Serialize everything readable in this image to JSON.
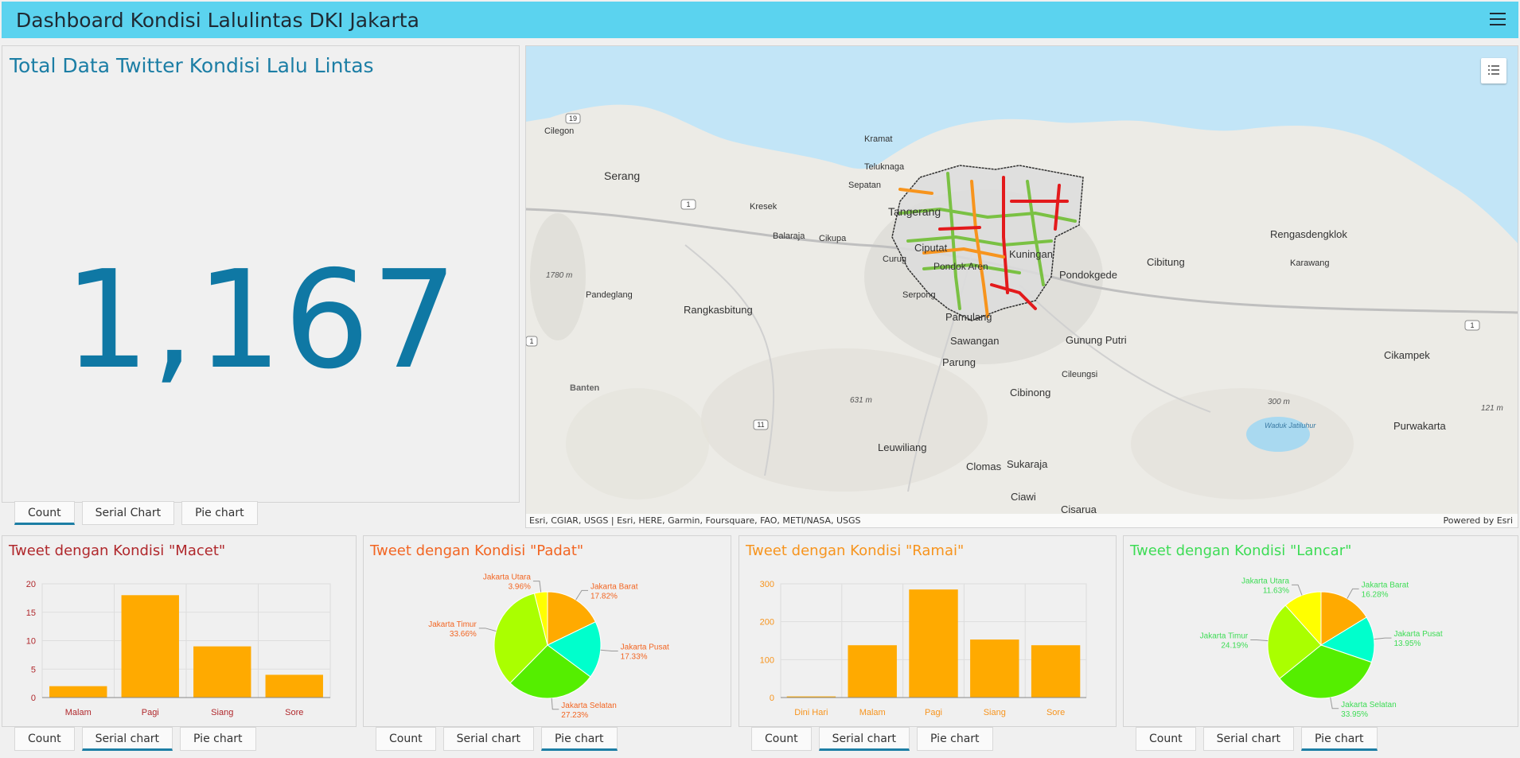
{
  "header": {
    "title": "Dashboard Kondisi Lalulintas DKI Jakarta",
    "menu_icon": "hamburger-menu-icon"
  },
  "count": {
    "title": "Total Data Twitter Kondisi Lalu Lintas",
    "value": "1,167",
    "color": "#0f78a4"
  },
  "top_tabs": [
    "Count",
    "Serial Chart",
    "Pie chart"
  ],
  "map": {
    "attribution": "Esri, CGIAR, USGS | Esri, HERE, Garmin, Foursquare, FAO, METI/NASA, USGS",
    "powered_by": "Powered by Esri",
    "places": [
      "Cilegon",
      "Serang",
      "Kramat",
      "Teluknaga",
      "Sepatan",
      "Kresek",
      "Tangerang",
      "Balaraja",
      "Cikupa",
      "Curug",
      "Ciputat",
      "Pondok Aren",
      "Kuningan",
      "Pondokgede",
      "Cibitung",
      "Rengasdengklok",
      "Karawang",
      "Pandeglang",
      "Rangkasbitung",
      "Serpong",
      "Pamulang",
      "Sawangan",
      "Gunung Putri",
      "Parung",
      "Cileungsi",
      "Cikampek",
      "Banten",
      "Cibinong",
      "Purwakarta",
      "Leuwiliang",
      "Clomas",
      "Sukaraja",
      "Ciawi",
      "Cisarua",
      "Waduk Jatiluhur"
    ],
    "elevations": [
      "1780 m",
      "631 m",
      "300 m",
      "121 m"
    ],
    "road_shields": [
      "19",
      "1",
      "1",
      "1",
      "11"
    ],
    "legend_icon": "legend-list-icon"
  },
  "macet": {
    "title": "Tweet dengan Kondisi \"Macet\"",
    "title_color": "#b0282c",
    "tabs": [
      "Count",
      "Serial chart",
      "Pie chart"
    ],
    "chart_data": {
      "type": "bar",
      "categories": [
        "Malam",
        "Pagi",
        "Siang",
        "Sore"
      ],
      "values": [
        2,
        18,
        9,
        4
      ],
      "ylim": [
        0,
        20
      ],
      "yticks": [
        0,
        5,
        10,
        15,
        20
      ],
      "color": "#ffaa00"
    }
  },
  "padat": {
    "title": "Tweet dengan Kondisi \"Padat\"",
    "title_color": "#f26522",
    "tabs": [
      "Count",
      "Serial chart",
      "Pie chart"
    ],
    "chart_data": {
      "type": "pie",
      "slices": [
        {
          "name": "Jakarta Barat",
          "pct": "17.82%",
          "value": 17.82,
          "color": "#ffaa00"
        },
        {
          "name": "Jakarta Pusat",
          "pct": "17.33%",
          "value": 17.33,
          "color": "#00ffcc"
        },
        {
          "name": "Jakarta Selatan",
          "pct": "27.23%",
          "value": 27.23,
          "color": "#55ee00"
        },
        {
          "name": "Jakarta Timur",
          "pct": "33.66%",
          "value": 33.66,
          "color": "#aaff00"
        },
        {
          "name": "Jakarta Utara",
          "pct": "3.96%",
          "value": 3.96,
          "color": "#ffff00"
        }
      ]
    }
  },
  "ramai": {
    "title": "Tweet dengan Kondisi \"Ramai\"",
    "title_color": "#f7941d",
    "tabs": [
      "Count",
      "Serial chart",
      "Pie chart"
    ],
    "chart_data": {
      "type": "bar",
      "categories": [
        "Dini Hari",
        "Malam",
        "Pagi",
        "Siang",
        "Sore"
      ],
      "values": [
        3,
        138,
        285,
        153,
        138
      ],
      "ylim": [
        0,
        300
      ],
      "yticks": [
        0,
        100,
        200,
        300
      ],
      "color": "#ffaa00"
    }
  },
  "lancar": {
    "title": "Tweet dengan Kondisi \"Lancar\"",
    "title_color": "#3ddc55",
    "tabs": [
      "Count",
      "Serial chart",
      "Pie chart"
    ],
    "chart_data": {
      "type": "pie",
      "slices": [
        {
          "name": "Jakarta Barat",
          "pct": "16.28%",
          "value": 16.28,
          "color": "#ffaa00"
        },
        {
          "name": "Jakarta Pusat",
          "pct": "13.95%",
          "value": 13.95,
          "color": "#00ffcc"
        },
        {
          "name": "Jakarta Selatan",
          "pct": "33.95%",
          "value": 33.95,
          "color": "#55ee00"
        },
        {
          "name": "Jakarta Timur",
          "pct": "24.19%",
          "value": 24.19,
          "color": "#aaff00"
        },
        {
          "name": "Jakarta Utara",
          "pct": "11.63%",
          "value": 11.63,
          "color": "#ffff00"
        }
      ]
    }
  }
}
